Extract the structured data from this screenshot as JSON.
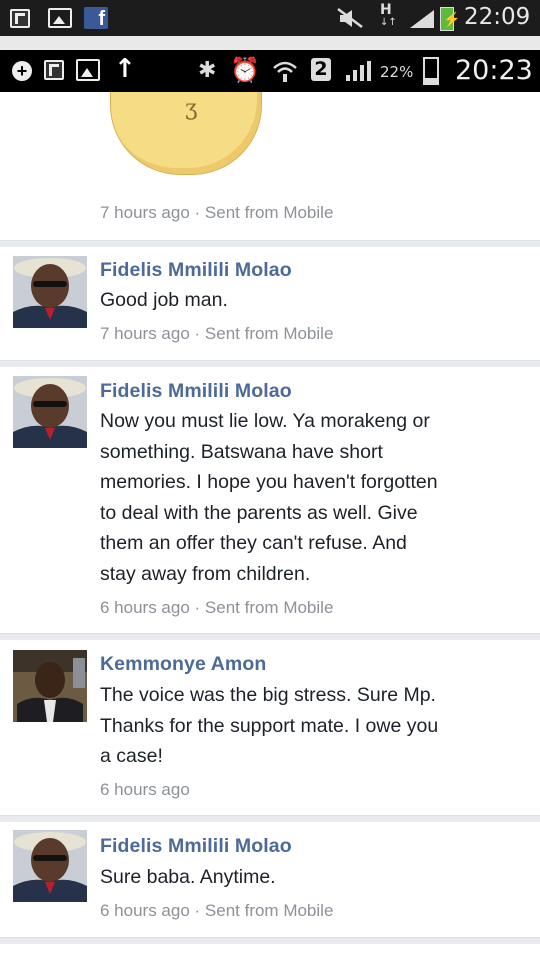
{
  "status_outer": {
    "time": "22:09",
    "net": "H"
  },
  "status_inner": {
    "sim": "2",
    "battery": "22%",
    "time": "20:23"
  },
  "posts": [
    {
      "meta": "7 hours ago · Sent from Mobile"
    },
    {
      "author": "Fidelis Mmilili Molao",
      "text": "Good job man.",
      "meta": "7 hours ago · Sent from Mobile"
    },
    {
      "author": "Fidelis Mmilili Molao",
      "lines": [
        "Now you must lie low. Ya morakeng or",
        "something. Batswana have short",
        "memories. I hope you haven't forgotten",
        "to deal with the parents as well. Give",
        "them an offer they can't refuse. And",
        "stay away from children."
      ],
      "meta": "6 hours ago · Sent from Mobile"
    },
    {
      "author": "Kemmonye Amon",
      "lines": [
        "The voice was the big stress. Sure Mp.",
        "Thanks for the support mate. I owe you",
        "a case!"
      ],
      "meta": "6 hours ago"
    },
    {
      "author": "Fidelis Mmilili Molao",
      "text": "Sure baba. Anytime.",
      "meta": "6 hours ago · Sent from Mobile"
    }
  ]
}
